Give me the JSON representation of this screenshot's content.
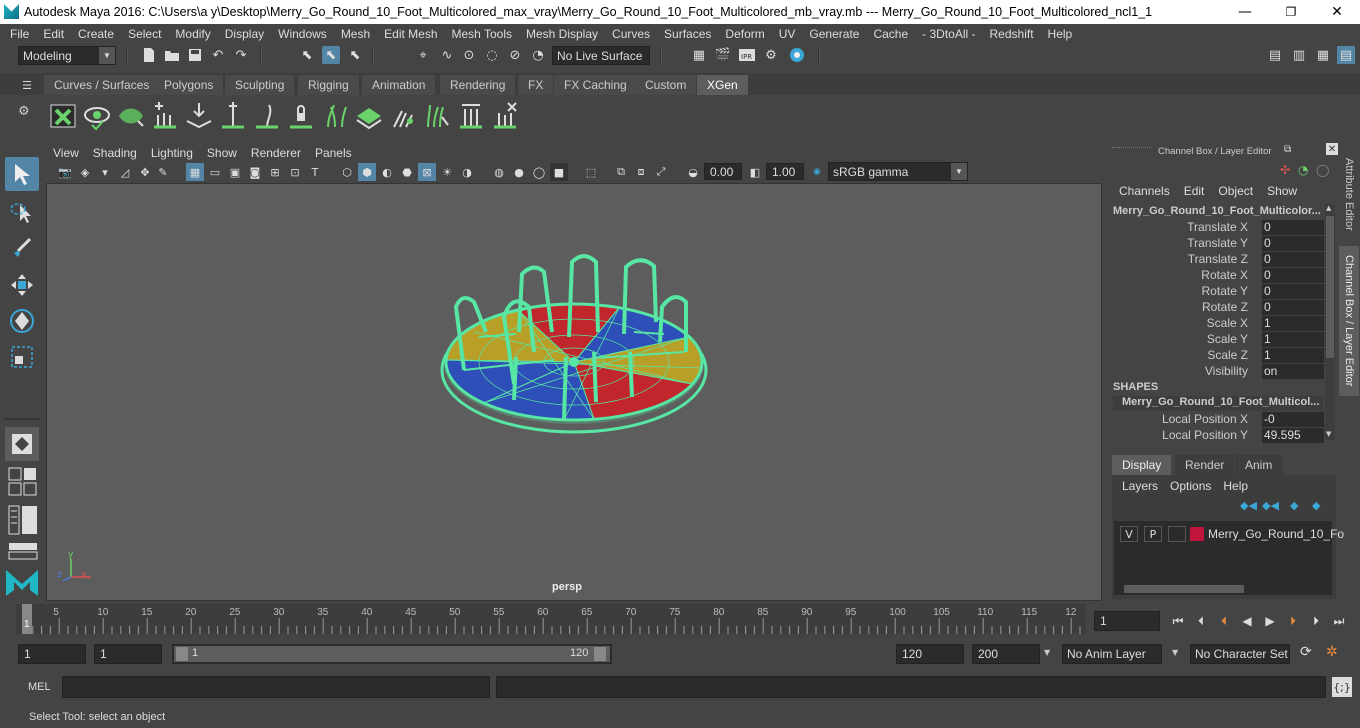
{
  "window": {
    "title": "Autodesk Maya 2016: C:\\Users\\a y\\Desktop\\Merry_Go_Round_10_Foot_Multicolored_max_vray\\Merry_Go_Round_10_Foot_Multicolored_mb_vray.mb   ---   Merry_Go_Round_10_Foot_Multicolored_ncl1_1",
    "minimize": "—",
    "maximize": "❐",
    "close": "✕"
  },
  "menu": [
    "File",
    "Edit",
    "Create",
    "Select",
    "Modify",
    "Display",
    "Windows",
    "Mesh",
    "Edit Mesh",
    "Mesh Tools",
    "Mesh Display",
    "Curves",
    "Surfaces",
    "Deform",
    "UV",
    "Generate",
    "Cache",
    "- 3DtoAll -",
    "Redshift",
    "Help"
  ],
  "status": {
    "mode": "Modeling",
    "live_surface": "No Live Surface"
  },
  "shelf_tabs": [
    {
      "label": "Curves / Surfaces"
    },
    {
      "label": "Polygons"
    },
    {
      "label": "Sculpting"
    },
    {
      "label": "Rigging"
    },
    {
      "label": "Animation"
    },
    {
      "label": "Rendering"
    },
    {
      "label": "FX"
    },
    {
      "label": "FX Caching"
    },
    {
      "label": "Custom"
    },
    {
      "label": "XGen",
      "active": true
    }
  ],
  "panel_menu": [
    "View",
    "Shading",
    "Lighting",
    "Show",
    "Renderer",
    "Panels"
  ],
  "panel_toolbar": {
    "exposure": "0.00",
    "gamma": "1.00",
    "color_space": "sRGB gamma"
  },
  "viewport": {
    "camera_label": "persp",
    "axis_x": "x",
    "axis_y": "y",
    "axis_z": "z"
  },
  "channel_box": {
    "header": "Channel Box / Layer Editor",
    "menu": [
      "Channels",
      "Edit",
      "Object",
      "Show"
    ],
    "object_name": "Merry_Go_Round_10_Foot_Multicolor...",
    "attributes": [
      {
        "label": "Translate X",
        "value": "0"
      },
      {
        "label": "Translate Y",
        "value": "0"
      },
      {
        "label": "Translate Z",
        "value": "0"
      },
      {
        "label": "Rotate X",
        "value": "0"
      },
      {
        "label": "Rotate Y",
        "value": "0"
      },
      {
        "label": "Rotate Z",
        "value": "0"
      },
      {
        "label": "Scale X",
        "value": "1"
      },
      {
        "label": "Scale Y",
        "value": "1"
      },
      {
        "label": "Scale Z",
        "value": "1"
      },
      {
        "label": "Visibility",
        "value": "on"
      }
    ],
    "shapes_header": "SHAPES",
    "shape_name": "Merry_Go_Round_10_Foot_Multicol...",
    "shape_attributes": [
      {
        "label": "Local Position X",
        "value": "-0"
      },
      {
        "label": "Local Position Y",
        "value": "49.595"
      }
    ]
  },
  "side_tabs": {
    "attribute_editor": "Attribute Editor",
    "channel_box": "Channel Box / Layer Editor"
  },
  "layer_editor": {
    "tabs": [
      "Display",
      "Render",
      "Anim"
    ],
    "menu": [
      "Layers",
      "Options",
      "Help"
    ],
    "layer": {
      "v": "V",
      "p": "P",
      "name": "Merry_Go_Round_10_Fo",
      "color": "#c0143c"
    }
  },
  "time_slider": {
    "ticks": [
      "5",
      "10",
      "15",
      "20",
      "25",
      "30",
      "35",
      "40",
      "45",
      "50",
      "55",
      "60",
      "65",
      "70",
      "75",
      "80",
      "85",
      "90",
      "95",
      "100",
      "105",
      "110",
      "115",
      "12"
    ],
    "current_frame": "1",
    "current_field": "1"
  },
  "range_slider": {
    "start": "1",
    "anim_start": "1",
    "range_start": "1",
    "range_end": "120",
    "playback_end": "120",
    "anim_end": "200",
    "anim_layer": "No Anim Layer",
    "character_set": "No Character Set"
  },
  "command_line": {
    "label": "MEL"
  },
  "help_line": "Select Tool: select an object",
  "colors": {
    "accent": "#5285a6",
    "wireframe": "#57e6a3",
    "seg_red": "#c0262b",
    "seg_blue": "#2e4fb8",
    "seg_yellow": "#b8a028"
  }
}
